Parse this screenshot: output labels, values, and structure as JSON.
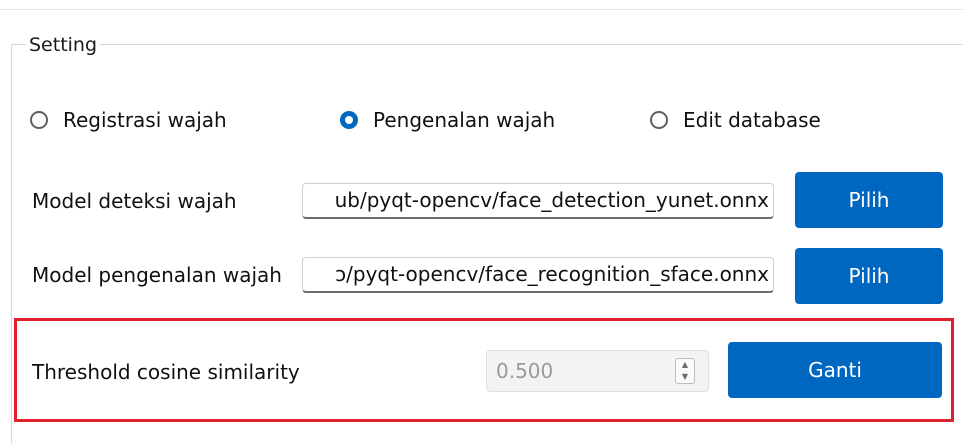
{
  "group": {
    "title": "Setting"
  },
  "modes": {
    "options": [
      {
        "label": "Registrasi wajah",
        "checked": false
      },
      {
        "label": "Pengenalan wajah",
        "checked": true
      },
      {
        "label": "Edit database",
        "checked": false
      }
    ]
  },
  "detection": {
    "label": "Model deteksi wajah",
    "path": "ub/pyqt-opencv/face_detection_yunet.onnx",
    "button": "Pilih"
  },
  "recognition": {
    "label": "Model pengenalan wajah",
    "path": "ɔ/pyqt-opencv/face_recognition_sface.onnx",
    "button": "Pilih"
  },
  "threshold": {
    "label": "Threshold cosine similarity",
    "value": "0.500",
    "button": "Ganti"
  },
  "colors": {
    "accent": "#0067c0",
    "highlight_border": "#e0202c",
    "disabled_text": "#9b9b9b"
  },
  "icons": {
    "spin_up": "▲",
    "spin_down": "▼"
  }
}
